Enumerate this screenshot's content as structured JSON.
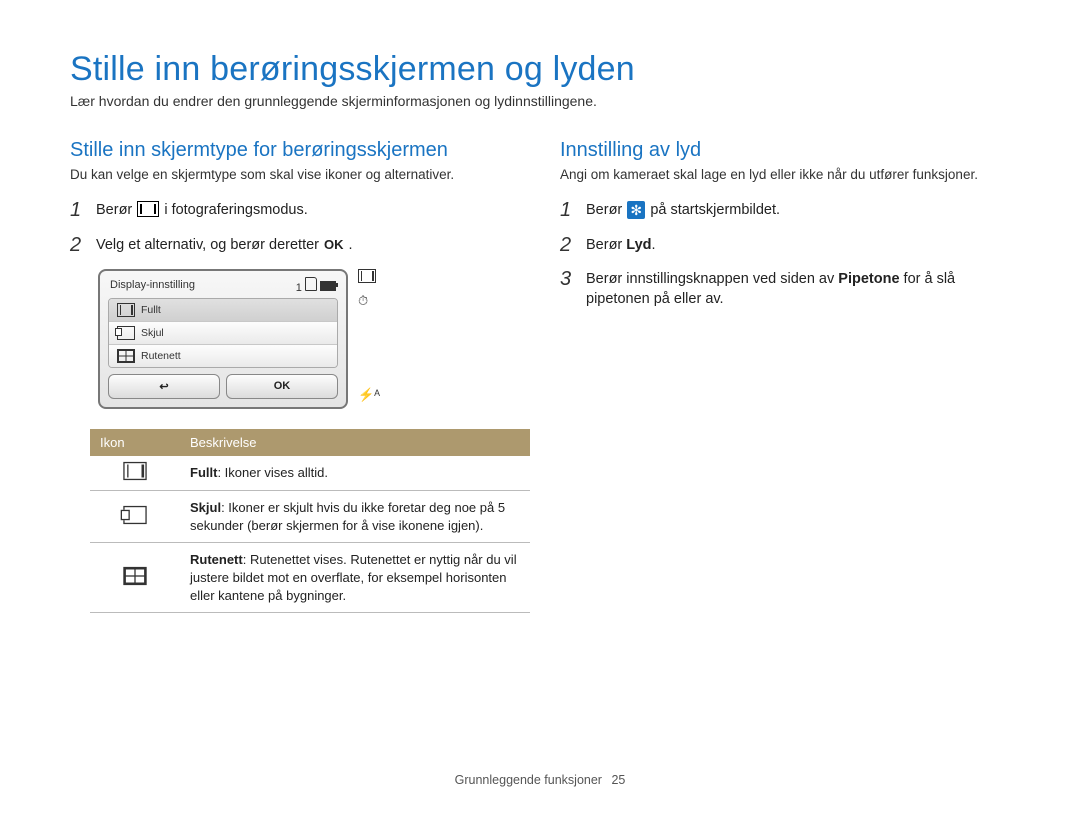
{
  "page_title": "Stille inn berøringsskjermen og lyden",
  "page_subtitle": "Lær hvordan du endrer den grunnleggende skjerminformasjonen og lydinnstillingene.",
  "left": {
    "heading": "Stille inn skjermtype for berøringsskjermen",
    "intro": "Du kan velge en skjermtype som skal vise ikoner og alternativer.",
    "step1_before": "Berør ",
    "step1_after": " i fotograferingsmodus.",
    "step2_before": "Velg et alternativ, og berør deretter ",
    "step2_ok": "OK",
    "step2_after": " .",
    "screen": {
      "title": "Display-innstilling",
      "counter": "1",
      "items": [
        "Fullt",
        "Skjul",
        "Rutenett"
      ],
      "back": "↩",
      "ok": "OK"
    },
    "table": {
      "col_icon": "Ikon",
      "col_desc": "Beskrivelse",
      "rows": [
        {
          "bold": "Fullt",
          "rest": ": Ikoner vises alltid."
        },
        {
          "bold": "Skjul",
          "rest": ": Ikoner er skjult hvis du ikke foretar deg noe på 5 sekunder (berør skjermen for å vise ikonene igjen)."
        },
        {
          "bold": "Rutenett",
          "rest": ": Rutenettet vises. Rutenettet er nyttig når du vil justere bildet mot en overflate, for eksempel horisonten eller kantene på bygninger."
        }
      ]
    }
  },
  "right": {
    "heading": "Innstilling av lyd",
    "intro": "Angi om kameraet skal lage en lyd eller ikke når du utfører funksjoner.",
    "step1_before": "Berør ",
    "step1_after": " på startskjermbildet.",
    "step2_before": "Berør ",
    "step2_bold": "Lyd",
    "step2_after": ".",
    "step3_before": "Berør innstillingsknappen ved siden av ",
    "step3_bold": "Pipetone",
    "step3_after": " for å slå pipetonen på eller av."
  },
  "footer": {
    "section": "Grunnleggende funksjoner",
    "page": "25"
  }
}
